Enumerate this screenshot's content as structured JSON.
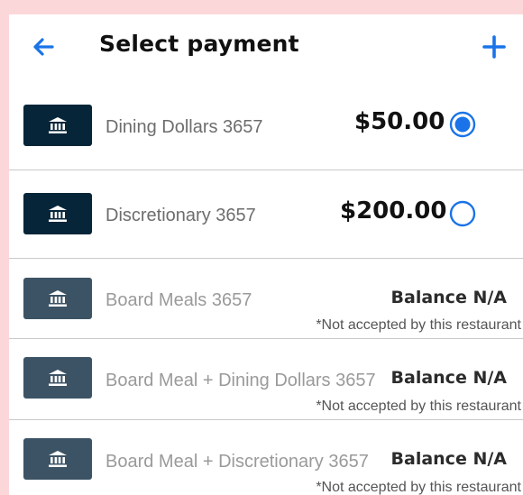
{
  "header": {
    "title": "Select payment",
    "back_icon": "arrow-left-icon",
    "add_icon": "plus-icon"
  },
  "payment_methods": [
    {
      "name": "Dining Dollars 3657",
      "amount": "$50.00",
      "selected": true,
      "enabled": true,
      "icon": "bank-icon"
    },
    {
      "name": "Discretionary 3657",
      "amount": "$200.00",
      "selected": false,
      "enabled": true,
      "icon": "bank-icon"
    },
    {
      "name": "Board Meals 3657",
      "balance": "Balance N/A",
      "note": "*Not accepted by this restaurant",
      "enabled": false,
      "icon": "bank-icon"
    },
    {
      "name": "Board Meal + Dining Dollars 3657",
      "balance": "Balance N/A",
      "note": "*Not accepted by this restaurant",
      "enabled": false,
      "icon": "bank-icon"
    },
    {
      "name": "Board Meal + Discretionary 3657",
      "balance": "Balance N/A",
      "note": "*Not accepted by this restaurant",
      "enabled": false,
      "icon": "bank-icon"
    }
  ],
  "colors": {
    "accent": "#1a73e8",
    "bank_enabled": "#062538",
    "bank_disabled": "#3c5365",
    "page_background": "#fcd7da"
  }
}
